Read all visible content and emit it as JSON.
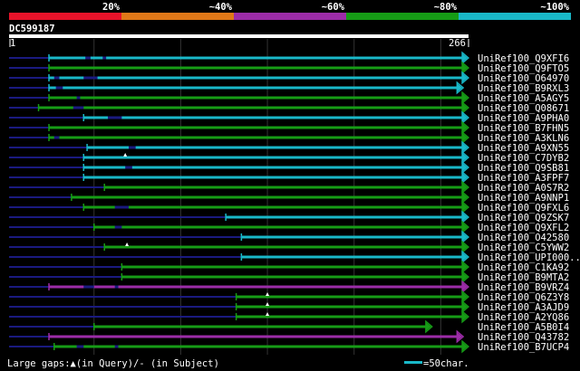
{
  "legend": {
    "labels": [
      "20%",
      "~40%",
      "~60%",
      "~80%",
      "~100%"
    ],
    "colors": [
      "#e8132a",
      "#e07818",
      "#9c2ca8",
      "#169c16",
      "#19b8c8"
    ]
  },
  "query": {
    "id": "DC599187",
    "start_label": "1",
    "end_label": "266",
    "length": 266
  },
  "alignment_colors": {
    "green": "#169c16",
    "cyan": "#19b8c8",
    "purple": "#9c2ca8",
    "line": "#1a1a80"
  },
  "hits": [
    {
      "label": "UniRef100_Q9XFI6",
      "start": 24,
      "end": 266,
      "color": "cyan",
      "gaps": [
        [
          45,
          48
        ],
        [
          55,
          57
        ]
      ],
      "arrow": true
    },
    {
      "label": "UniRef100_Q9FTO5",
      "start": 24,
      "end": 266,
      "color": "green",
      "gaps": [],
      "arrow": true
    },
    {
      "label": "UniRef100_O64970",
      "start": 24,
      "end": 266,
      "color": "cyan",
      "gaps": [
        [
          27,
          30
        ],
        [
          44,
          52
        ]
      ],
      "arrow": true
    },
    {
      "label": "UniRef100_B9RXL3",
      "start": 24,
      "end": 263,
      "color": "cyan",
      "gaps": [
        [
          28,
          32
        ]
      ],
      "arrow": true
    },
    {
      "label": "UniRef100_A5AGY5",
      "start": 24,
      "end": 266,
      "color": "green",
      "gaps": [
        [
          40,
          42
        ]
      ],
      "arrow": true
    },
    {
      "label": "UniRef100_Q08671",
      "start": 18,
      "end": 266,
      "color": "green",
      "gaps": [
        [
          38,
          44
        ]
      ],
      "arrow": true
    },
    {
      "label": "UniRef100_A9PHA0",
      "start": 44,
      "end": 266,
      "color": "cyan",
      "gaps": [
        [
          58,
          66
        ]
      ],
      "arrow": true
    },
    {
      "label": "UniRef100_B7FHN5",
      "start": 24,
      "end": 266,
      "color": "green",
      "gaps": [],
      "arrow": true
    },
    {
      "label": "UniRef100_A3KLN6",
      "start": 24,
      "end": 266,
      "color": "green",
      "gaps": [
        [
          27,
          30
        ]
      ],
      "arrow": true
    },
    {
      "label": "UniRef100_A9XN55",
      "start": 46,
      "end": 266,
      "color": "cyan",
      "gaps": [
        [
          70,
          74
        ]
      ],
      "arrow": true
    },
    {
      "label": "UniRef100_C7DYB2",
      "start": 44,
      "end": 266,
      "color": "cyan",
      "gaps": [],
      "arrow": true
    },
    {
      "label": "UniRef100_Q9SB81",
      "start": 44,
      "end": 266,
      "color": "cyan",
      "gaps": [
        [
          68,
          72
        ]
      ],
      "arrow": true
    },
    {
      "label": "UniRef100_A3FPF7",
      "start": 44,
      "end": 266,
      "color": "cyan",
      "gaps": [],
      "arrow": true
    },
    {
      "label": "UniRef100_A0S7R2",
      "start": 56,
      "end": 266,
      "color": "green",
      "gaps": [],
      "arrow": true
    },
    {
      "label": "UniRef100_A9NNP1",
      "start": 37,
      "end": 266,
      "color": "green",
      "gaps": [],
      "arrow": true
    },
    {
      "label": "UniRef100_Q9FXL6",
      "start": 44,
      "end": 266,
      "color": "green",
      "gaps": [
        [
          62,
          70
        ]
      ],
      "arrow": true
    },
    {
      "label": "UniRef100_Q9ZSK7",
      "start": 126,
      "end": 266,
      "color": "cyan",
      "gaps": [],
      "arrow": true
    },
    {
      "label": "UniRef100_Q9XFL2",
      "start": 50,
      "end": 266,
      "color": "green",
      "gaps": [
        [
          62,
          66
        ]
      ],
      "arrow": true
    },
    {
      "label": "UniRef100_O42580",
      "start": 135,
      "end": 266,
      "color": "cyan",
      "gaps": [],
      "arrow": true
    },
    {
      "label": "UniRef100_C5YWW2",
      "start": 56,
      "end": 266,
      "color": "green",
      "gaps": [],
      "arrow": true
    },
    {
      "label": "UniRef100_UPI000..",
      "start": 135,
      "end": 266,
      "color": "cyan",
      "gaps": [],
      "arrow": true
    },
    {
      "label": "UniRef100_C1KA92",
      "start": 66,
      "end": 266,
      "color": "green",
      "gaps": [],
      "arrow": true
    },
    {
      "label": "UniRef100_B9MTA2",
      "start": 66,
      "end": 266,
      "color": "green",
      "gaps": [],
      "arrow": true
    },
    {
      "label": "UniRef100_B9VRZ4",
      "start": 24,
      "end": 266,
      "color": "purple",
      "gaps": [
        [
          44,
          50
        ],
        [
          62,
          64
        ]
      ],
      "arrow": true
    },
    {
      "label": "UniRef100_Q6Z3Y8",
      "start": 132,
      "end": 266,
      "color": "green",
      "gaps": [],
      "arrow": true
    },
    {
      "label": "UniRef100_A3AJD9",
      "start": 132,
      "end": 266,
      "color": "green",
      "gaps": [],
      "arrow": true
    },
    {
      "label": "UniRef100_A2YQ86",
      "start": 132,
      "end": 266,
      "color": "green",
      "gaps": [],
      "arrow": true
    },
    {
      "label": "UniRef100_A5B0I4",
      "start": 50,
      "end": 245,
      "color": "green",
      "gaps": [],
      "arrow": true
    },
    {
      "label": "UniRef100_Q43782",
      "start": 24,
      "end": 263,
      "color": "purple",
      "gaps": [],
      "arrow": true
    },
    {
      "label": "UniRef100_B7UCP4",
      "start": 27,
      "end": 266,
      "color": "green",
      "gaps": [
        [
          40,
          44
        ],
        [
          62,
          64
        ]
      ],
      "arrow": true
    }
  ],
  "footer": {
    "gaps_text": "Large gaps:▲(in Query)/- (in Subject)",
    "scale_text": "=50char."
  }
}
